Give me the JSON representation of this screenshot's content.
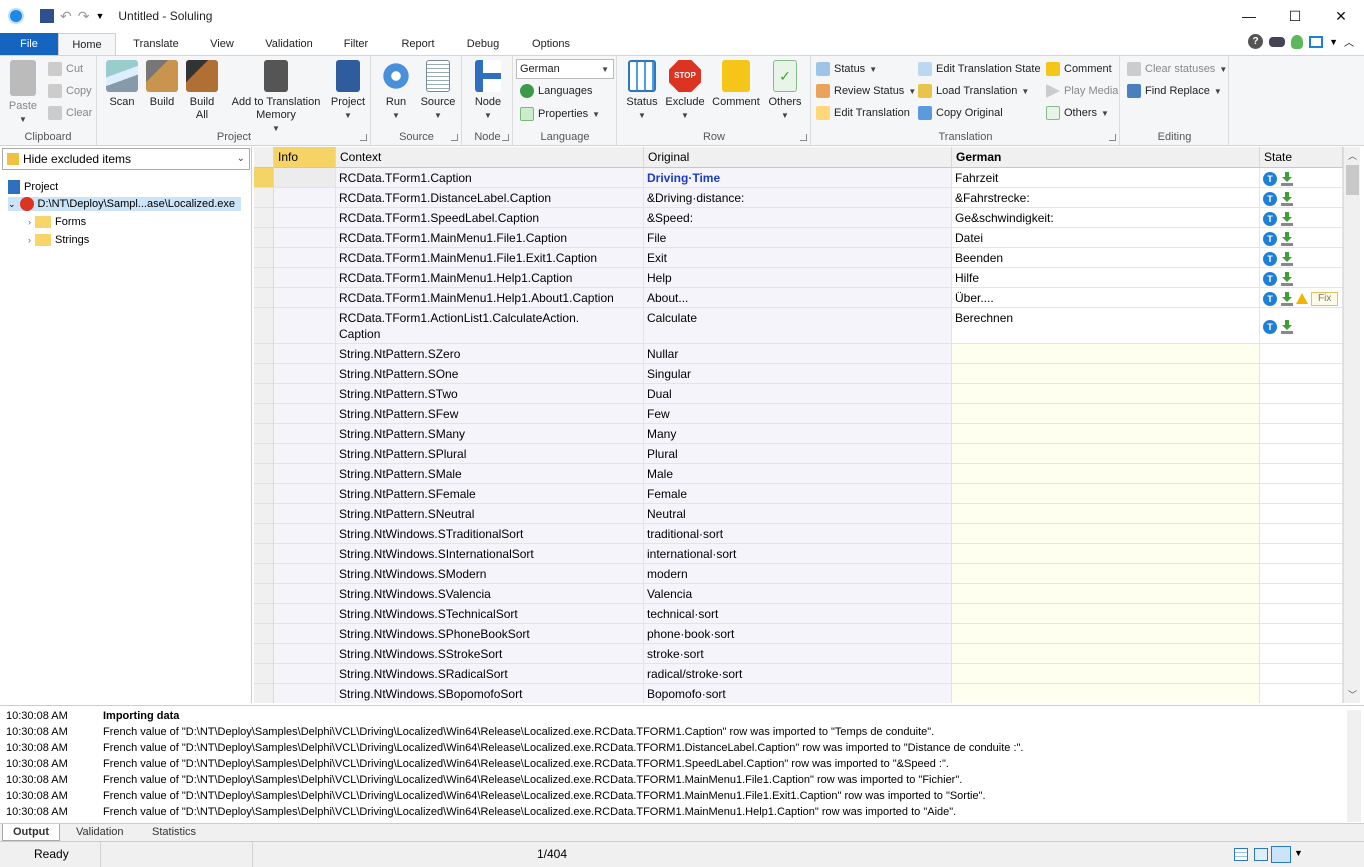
{
  "window": {
    "title": "Untitled  -  Soluling"
  },
  "tabs": [
    {
      "label": "File"
    },
    {
      "label": "Home"
    },
    {
      "label": "Translate"
    },
    {
      "label": "View"
    },
    {
      "label": "Validation"
    },
    {
      "label": "Filter"
    },
    {
      "label": "Report"
    },
    {
      "label": "Debug"
    },
    {
      "label": "Options"
    }
  ],
  "ribbon": {
    "clipboard": {
      "label": "Clipboard",
      "paste": "Paste",
      "cut": "Cut",
      "copy": "Copy",
      "clear": "Clear"
    },
    "project": {
      "label": "Project",
      "scan": "Scan",
      "build": "Build",
      "build_all": "Build All",
      "add_tm": "Add to Translation Memory",
      "project": "Project"
    },
    "source": {
      "label": "Source",
      "run": "Run",
      "source": "Source"
    },
    "node": {
      "label": "Node",
      "node": "Node"
    },
    "language": {
      "label": "Language",
      "selected": "German",
      "languages": "Languages",
      "properties": "Properties"
    },
    "row": {
      "label": "Row",
      "status": "Status",
      "exclude": "Exclude",
      "comment": "Comment",
      "others": "Others"
    },
    "translation": {
      "label": "Translation",
      "status": "Status",
      "review_status": "Review Status",
      "edit_translation": "Edit Translation",
      "edit_state": "Edit Translation State",
      "load_translation": "Load Translation",
      "copy_original": "Copy Original",
      "comment": "Comment",
      "play_media": "Play Media",
      "others": "Others"
    },
    "editing": {
      "label": "Editing",
      "clear_statuses": "Clear statuses",
      "find_replace": "Find  Replace"
    }
  },
  "tree": {
    "filter": "Hide excluded items",
    "project": "Project",
    "file": "D:\\NT\\Deploy\\Sampl...ase\\Localized.exe",
    "forms": "Forms",
    "strings": "Strings"
  },
  "grid": {
    "headers": {
      "info": "Info",
      "context": "Context",
      "original": "Original",
      "german": "German",
      "state": "State"
    },
    "rows": [
      {
        "context": "RCData.TForm1.Caption",
        "original": "Driving·Time",
        "german": "Fahrzeit",
        "translated": true
      },
      {
        "context": "RCData.TForm1.DistanceLabel.Caption",
        "original": "&Driving·distance:",
        "german": "&Fahrstrecke:",
        "translated": true
      },
      {
        "context": "RCData.TForm1.SpeedLabel.Caption",
        "original": "&Speed:",
        "german": "Ge&schwindigkeit:",
        "translated": true
      },
      {
        "context": "RCData.TForm1.MainMenu1.File1.Caption",
        "original": "File",
        "german": "Datei",
        "translated": true
      },
      {
        "context": "RCData.TForm1.MainMenu1.File1.Exit1.Caption",
        "original": "Exit",
        "german": "Beenden",
        "translated": true
      },
      {
        "context": "RCData.TForm1.MainMenu1.Help1.Caption",
        "original": "Help",
        "german": "Hilfe",
        "translated": true
      },
      {
        "context": "RCData.TForm1.MainMenu1.Help1.About1.Caption",
        "original": "About...",
        "german": "Über....",
        "translated": true,
        "fix": "Fix"
      },
      {
        "context": "RCData.TForm1.ActionList1.CalculateAction.\nCaption",
        "original": "Calculate",
        "german": "Berechnen",
        "translated": true
      },
      {
        "context": "String.NtPattern.SZero",
        "original": "Nullar",
        "german": "",
        "translated": false
      },
      {
        "context": "String.NtPattern.SOne",
        "original": "Singular",
        "german": "",
        "translated": false
      },
      {
        "context": "String.NtPattern.STwo",
        "original": "Dual",
        "german": "",
        "translated": false
      },
      {
        "context": "String.NtPattern.SFew",
        "original": "Few",
        "german": "",
        "translated": false
      },
      {
        "context": "String.NtPattern.SMany",
        "original": "Many",
        "german": "",
        "translated": false
      },
      {
        "context": "String.NtPattern.SPlural",
        "original": "Plural",
        "german": "",
        "translated": false
      },
      {
        "context": "String.NtPattern.SMale",
        "original": "Male",
        "german": "",
        "translated": false
      },
      {
        "context": "String.NtPattern.SFemale",
        "original": "Female",
        "german": "",
        "translated": false
      },
      {
        "context": "String.NtPattern.SNeutral",
        "original": "Neutral",
        "german": "",
        "translated": false
      },
      {
        "context": "String.NtWindows.STraditionalSort",
        "original": "traditional·sort",
        "german": "",
        "translated": false
      },
      {
        "context": "String.NtWindows.SInternationalSort",
        "original": "international·sort",
        "german": "",
        "translated": false
      },
      {
        "context": "String.NtWindows.SModern",
        "original": "modern",
        "german": "",
        "translated": false
      },
      {
        "context": "String.NtWindows.SValencia",
        "original": "Valencia",
        "german": "",
        "translated": false
      },
      {
        "context": "String.NtWindows.STechnicalSort",
        "original": "technical·sort",
        "german": "",
        "translated": false
      },
      {
        "context": "String.NtWindows.SPhoneBookSort",
        "original": "phone·book·sort",
        "german": "",
        "translated": false
      },
      {
        "context": "String.NtWindows.SStrokeSort",
        "original": "stroke·sort",
        "german": "",
        "translated": false
      },
      {
        "context": "String.NtWindows.SRadicalSort",
        "original": "radical/stroke·sort",
        "german": "",
        "translated": false
      },
      {
        "context": "String.NtWindows.SBopomofoSort",
        "original": "Bopomofo·sort",
        "german": "",
        "translated": false
      }
    ]
  },
  "output": {
    "lines": [
      {
        "time": "10:30:08 AM",
        "msg": "Importing data",
        "bold": true
      },
      {
        "time": "10:30:08 AM",
        "msg": "French value of \"D:\\NT\\Deploy\\Samples\\Delphi\\VCL\\Driving\\Localized\\Win64\\Release\\Localized.exe.RCData.TFORM1.Caption\" row was imported to \"Temps de conduite\"."
      },
      {
        "time": "10:30:08 AM",
        "msg": "French value of \"D:\\NT\\Deploy\\Samples\\Delphi\\VCL\\Driving\\Localized\\Win64\\Release\\Localized.exe.RCData.TFORM1.DistanceLabel.Caption\" row was imported to \"Distance de conduite :\"."
      },
      {
        "time": "10:30:08 AM",
        "msg": "French value of \"D:\\NT\\Deploy\\Samples\\Delphi\\VCL\\Driving\\Localized\\Win64\\Release\\Localized.exe.RCData.TFORM1.SpeedLabel.Caption\" row was imported to \"&Speed :\"."
      },
      {
        "time": "10:30:08 AM",
        "msg": "French value of \"D:\\NT\\Deploy\\Samples\\Delphi\\VCL\\Driving\\Localized\\Win64\\Release\\Localized.exe.RCData.TFORM1.MainMenu1.File1.Caption\" row was imported to \"Fichier\"."
      },
      {
        "time": "10:30:08 AM",
        "msg": "French value of \"D:\\NT\\Deploy\\Samples\\Delphi\\VCL\\Driving\\Localized\\Win64\\Release\\Localized.exe.RCData.TFORM1.MainMenu1.File1.Exit1.Caption\" row was imported to \"Sortie\"."
      },
      {
        "time": "10:30:08 AM",
        "msg": "French value of \"D:\\NT\\Deploy\\Samples\\Delphi\\VCL\\Driving\\Localized\\Win64\\Release\\Localized.exe.RCData.TFORM1.MainMenu1.Help1.Caption\" row was imported to \"Aide\"."
      }
    ]
  },
  "bottom_tabs": [
    {
      "label": "Output"
    },
    {
      "label": "Validation"
    },
    {
      "label": "Statistics"
    }
  ],
  "status": {
    "ready": "Ready",
    "position": "1/404"
  },
  "colors": {
    "accent": "#1565c0",
    "untranslated_bg": "#fffff0",
    "badge": "#1e7fd6",
    "bold_original": "#1a3cc8"
  }
}
